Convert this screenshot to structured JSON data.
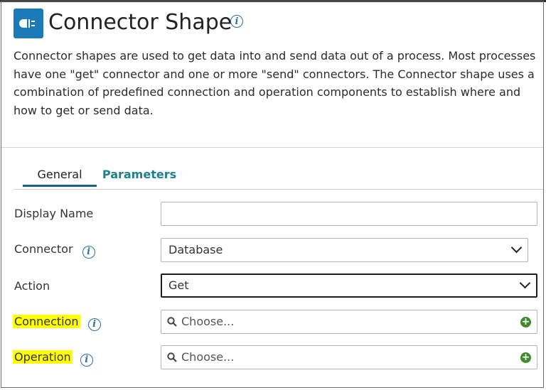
{
  "header": {
    "title": "Connector Shape",
    "icon": "connector-plug-icon",
    "info_glyph": "i",
    "description": "Connector shapes are used to get data into and send data out of a process. Most processes have one \"get\" connector and one or more \"send\" connectors. The Connector shape uses a combination of predefined connection and operation components to establish where and how to get or send data."
  },
  "tabs": [
    {
      "label": "General",
      "active": true
    },
    {
      "label": "Parameters",
      "active": false
    }
  ],
  "form": {
    "display_name": {
      "label": "Display Name",
      "value": ""
    },
    "connector": {
      "label": "Connector",
      "value": "Database"
    },
    "action": {
      "label": "Action",
      "value": "Get"
    },
    "connection": {
      "label": "Connection",
      "placeholder": "Choose..."
    },
    "operation": {
      "label": "Operation",
      "placeholder": "Choose..."
    }
  },
  "colors": {
    "accent": "#1b7bb8",
    "tab_link": "#1e7f8f",
    "add_button": "#3f8a2d",
    "highlight": "#ffff00"
  }
}
